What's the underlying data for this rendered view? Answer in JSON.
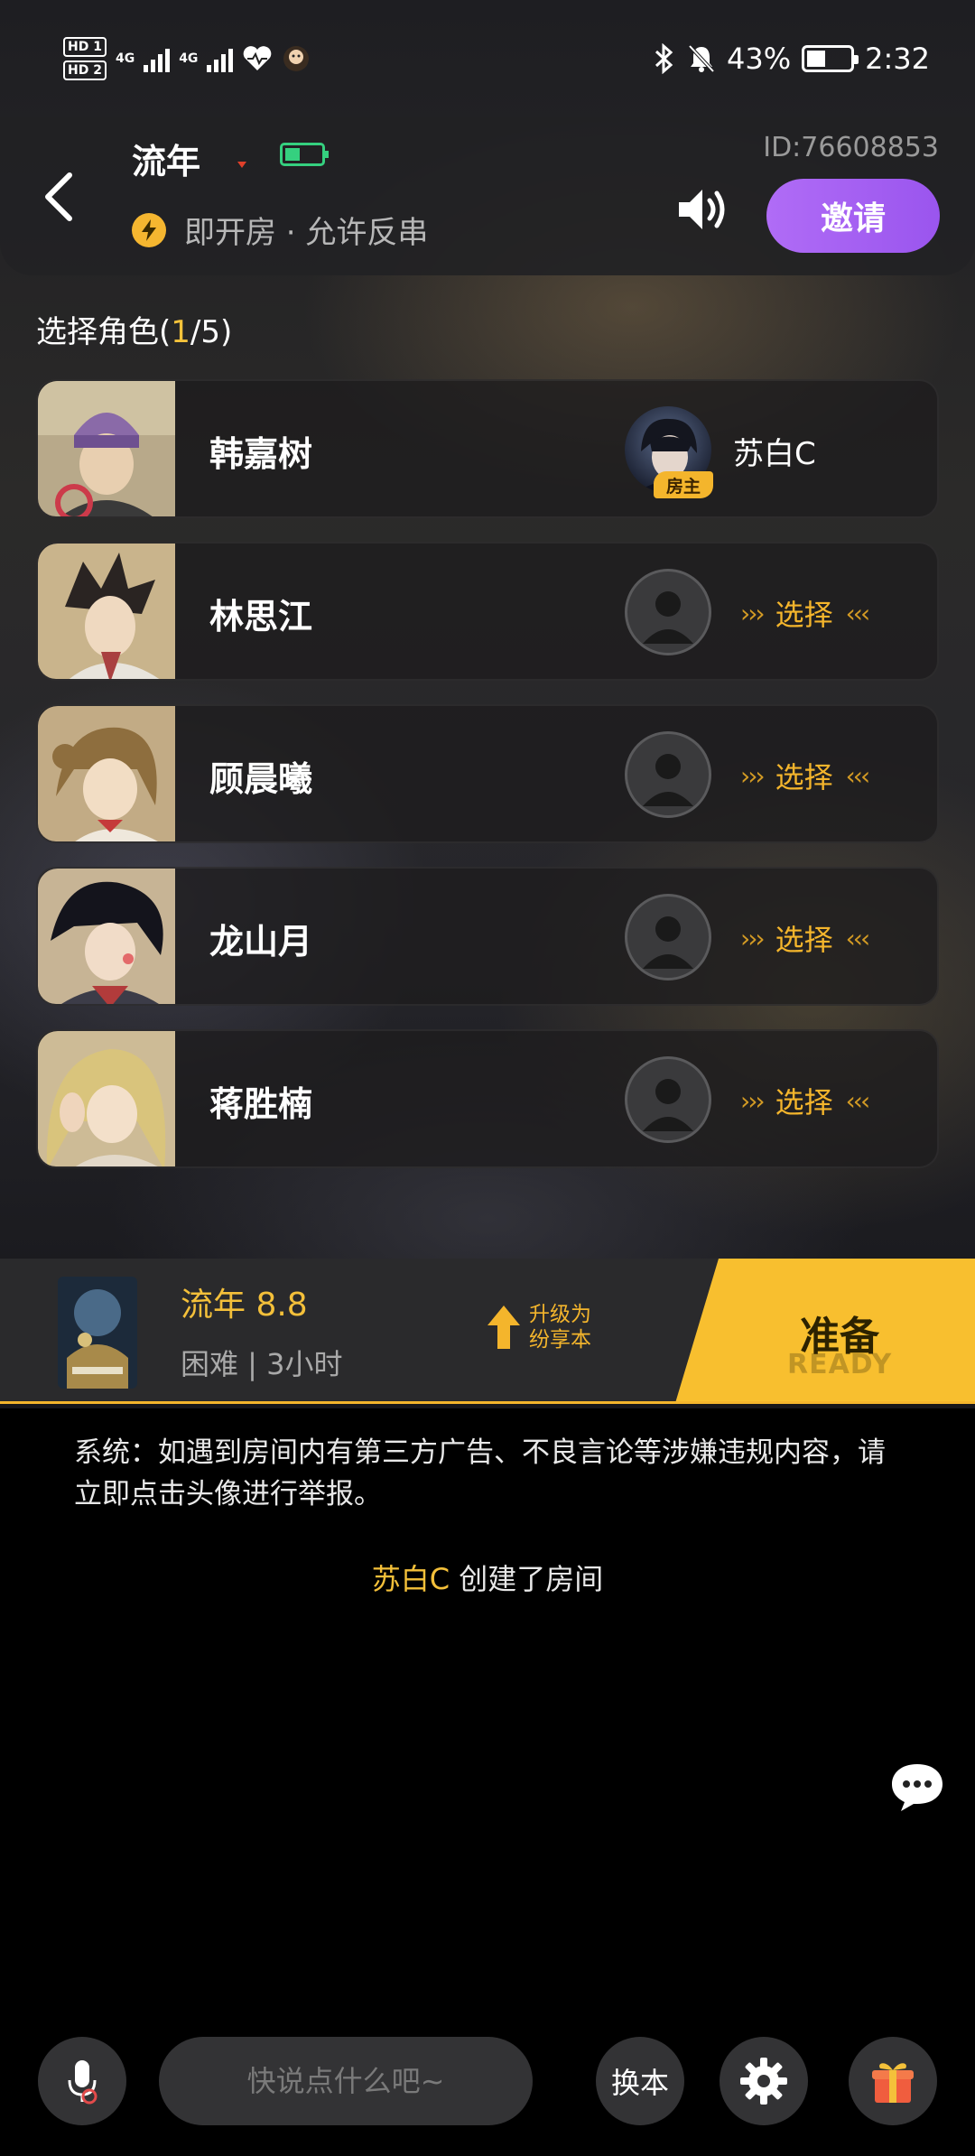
{
  "status_bar": {
    "hd1": "HD 1",
    "hd2": "HD 2",
    "net1": "4G",
    "net2": "4G",
    "battery_percent": "43%",
    "time": "2:32"
  },
  "header": {
    "title": "流年",
    "room_mode": "即开房 · 允许反串",
    "room_id": "ID:76608853",
    "invite_label": "邀请"
  },
  "roles_section": {
    "label_prefix": "选择角色(",
    "selected": "1",
    "label_suffix": "/5)"
  },
  "roles": [
    {
      "name": "韩嘉树",
      "occupant": "苏白C",
      "host_badge": "房主"
    },
    {
      "name": "林思江",
      "select_label": "选择"
    },
    {
      "name": "顾晨曦",
      "select_label": "选择"
    },
    {
      "name": "龙山月",
      "select_label": "选择"
    },
    {
      "name": "蒋胜楠",
      "select_label": "选择"
    }
  ],
  "script": {
    "name_score": "流年 8.8",
    "meta": "困难 | 3小时",
    "upgrade_line1": "升级为",
    "upgrade_line2": "纷享本",
    "ready_label": "准备",
    "ready_sub": "READY"
  },
  "chat": {
    "system_message": "系统：如遇到房间内有第三方广告、不良言论等涉嫌违规内容，请立即点击头像进行举报。",
    "event_user": "苏白C",
    "event_text": " 创建了房间"
  },
  "bottom_bar": {
    "input_placeholder": "快说点什么吧~",
    "swap_label": "换本"
  },
  "colors": {
    "accent_gold": "#f4b52c",
    "invite_purple": "#a35ff1",
    "ready_yellow": "#f8bf2f"
  }
}
